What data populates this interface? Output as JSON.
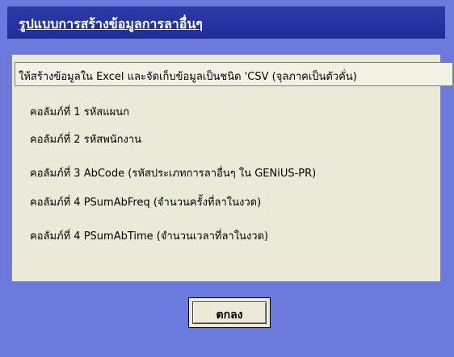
{
  "dialog": {
    "title": "รูปแบบการสร้างข้อมูลการลาอื่นๆ",
    "header_text": "ให้สร้างข้อมูลใน Excel และจัดเก็บข้อมูลเป็นชนิด 'CSV (จุลภาคเป็นตัวคั่น)",
    "columns": [
      "คอลัมภ์ที่ 1 รหัสแผนก",
      "คอลัมภ์ที่ 2 รหัสพนักงาน",
      "คอลัมภ์ที่ 3 AbCode (รหัสประเภทการลาอื่นๆ ใน GENiUS-PR)",
      "คอลัมภ์ที่ 4 PSumAbFreq (จำนวนครั้งที่ลาในงวด)",
      "คอลัมภ์ที่ 4 PSumAbTime (จำนวนเวลาที่ลาในงวด)"
    ],
    "ok_label": "ตกลง"
  },
  "colors": {
    "background": "#6c79dd",
    "title_bar": "#2433a0",
    "panel": "#ebe9d8"
  }
}
